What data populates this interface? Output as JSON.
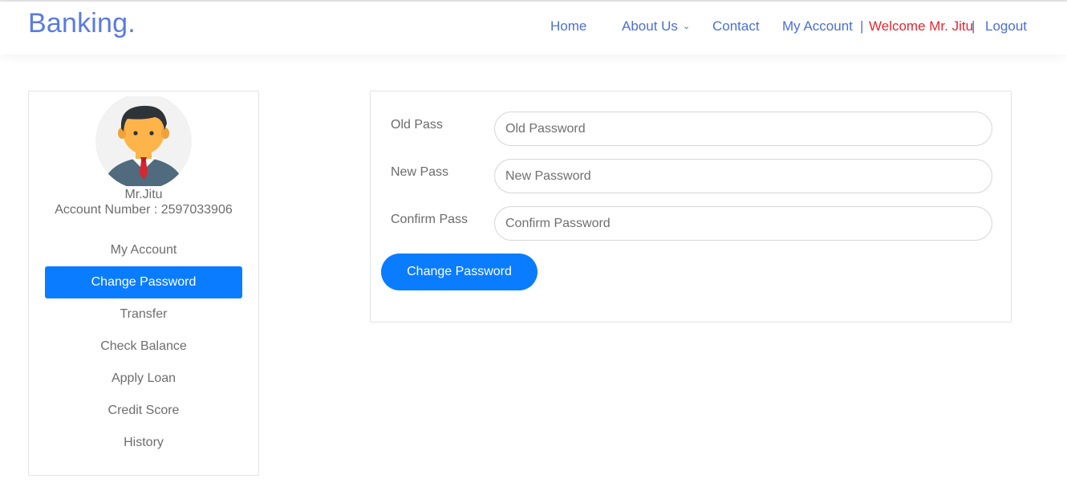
{
  "header": {
    "brand": "Banking.",
    "nav": {
      "home": "Home",
      "about": "About Us",
      "contact": "Contact",
      "my_account": "My Account",
      "sep1": "|",
      "welcome": "Welcome Mr. Jitu",
      "sep2": "|",
      "logout": "Logout"
    }
  },
  "sidebar": {
    "user_name": "Mr.Jitu",
    "account_number": "Account Number : 2597033906",
    "items": [
      {
        "label": "My Account"
      },
      {
        "label": "Change Password",
        "active": true
      },
      {
        "label": "Transfer"
      },
      {
        "label": "Check Balance"
      },
      {
        "label": "Apply Loan"
      },
      {
        "label": "Credit Score"
      },
      {
        "label": "History"
      }
    ]
  },
  "form": {
    "old": {
      "label": "Old Pass",
      "placeholder": "Old Password",
      "value": ""
    },
    "new": {
      "label": "New Pass",
      "placeholder": "New Password",
      "value": ""
    },
    "confirm": {
      "label": "Confirm Pass",
      "placeholder": "Confirm Password",
      "value": ""
    },
    "submit_label": "Change Password"
  },
  "colors": {
    "brand": "#5a7be0",
    "link": "#4a6fd6",
    "welcome": "#e8262f",
    "primary": "#0a7cff"
  },
  "icons": {
    "avatar": "user-avatar-icon",
    "dropdown": "chevron-down-icon"
  }
}
